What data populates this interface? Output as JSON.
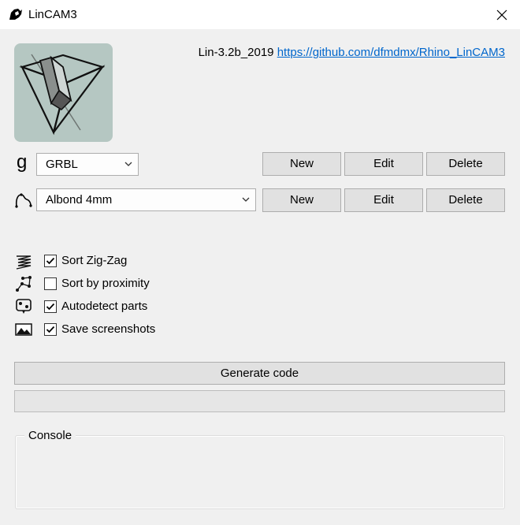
{
  "window": {
    "title": "LinCAM3",
    "close_glyph": "✕"
  },
  "header": {
    "version": "Lin-3.2b_2019",
    "link_text": "https://github.com/dfmdmx/Rhino_LinCAM3"
  },
  "machine_row": {
    "icon": "g",
    "selected": "GRBL",
    "new_label": "New",
    "edit_label": "Edit",
    "delete_label": "Delete"
  },
  "material_row": {
    "icon": "toolpath-curve-icon",
    "selected": "Albond 4mm",
    "new_label": "New",
    "edit_label": "Edit",
    "delete_label": "Delete"
  },
  "options": [
    {
      "label": "Sort Zig-Zag",
      "checked": true,
      "icon": "zigzag-icon"
    },
    {
      "label": "Sort by proximity",
      "checked": false,
      "icon": "proximity-icon"
    },
    {
      "label": "Autodetect parts",
      "checked": true,
      "icon": "autodetect-icon"
    },
    {
      "label": "Save screenshots",
      "checked": true,
      "icon": "screenshot-icon"
    }
  ],
  "generate": {
    "label": "Generate code"
  },
  "progress": {
    "value": 0
  },
  "console": {
    "label": "Console",
    "text": ""
  }
}
